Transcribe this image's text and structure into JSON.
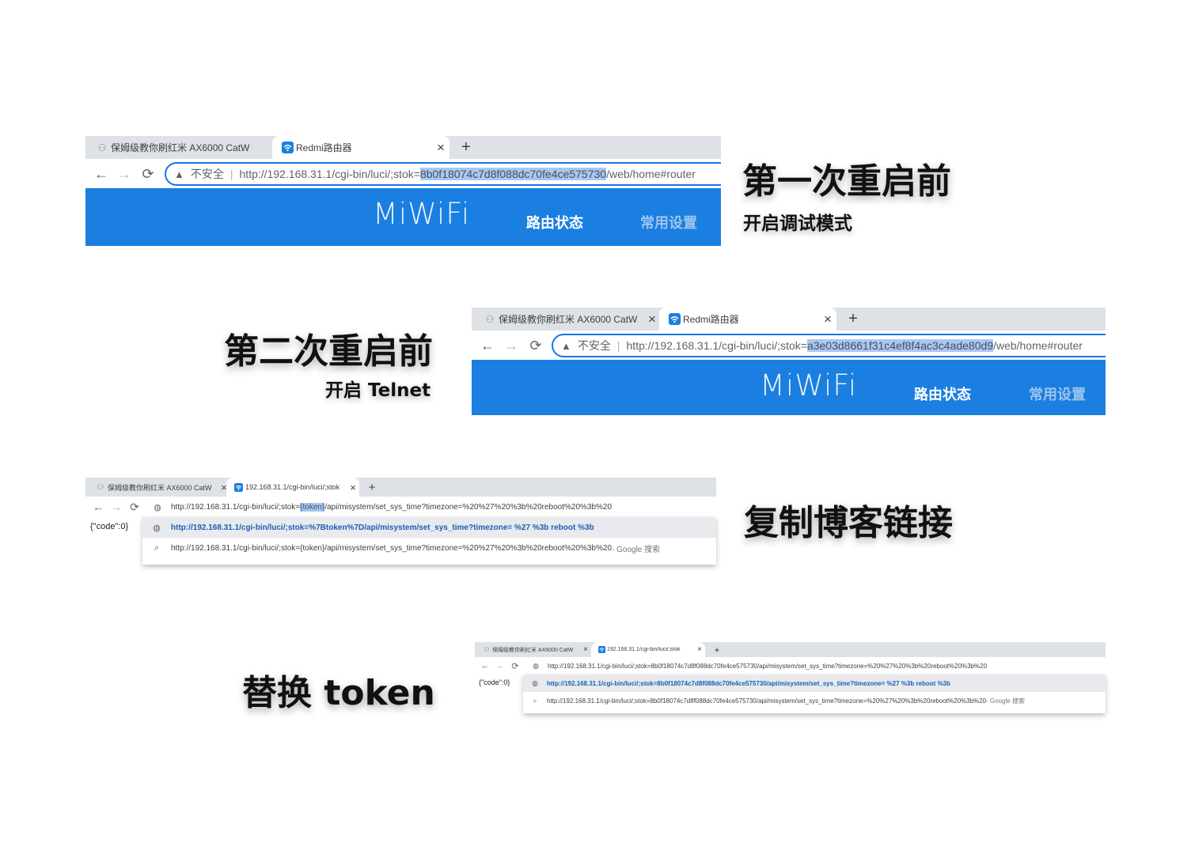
{
  "panel1": {
    "tab1_title": "保姆级教你刷红米 AX6000 CatW",
    "tab2_title": "Redmi路由器",
    "close": "×",
    "newtab": "+",
    "insecure_label": "不安全",
    "separator": "|",
    "url_prefix": "http://192.168.31.1/cgi-bin/luci/;stok=",
    "url_token": "8b0f18074c7d8f088dc70fe4ce575730",
    "url_suffix": "/web/home#router",
    "logo": "MiWiFi",
    "nav_status": "路由状态",
    "nav_settings": "常用设置",
    "caption": "第一次重启前",
    "subcaption": "开启调试模式"
  },
  "panel2": {
    "tab1_title": "保姆级教你刷红米 AX6000 CatW",
    "tab2_title": "Redmi路由器",
    "close": "×",
    "newtab": "+",
    "insecure_label": "不安全",
    "separator": "|",
    "url_prefix": "http://192.168.31.1/cgi-bin/luci/;stok=",
    "url_token": "a3e03d8661f31c4ef8f4ac3c4ade80d9",
    "url_suffix": "/web/home#router",
    "logo": "MiWiFi",
    "nav_status": "路由状态",
    "nav_settings": "常用设置",
    "caption": "第二次重启前",
    "subcaption": "开启 Telnet"
  },
  "panel3": {
    "tab1_title": "保姆级教你刷红米 AX6000 CatW",
    "tab2_title": "192.168.31.1/cgi-bin/luci/;stok",
    "close": "×",
    "newtab": "+",
    "url_prefix": "http://192.168.31.1/cgi-bin/luci/;stok=",
    "url_token": "{token}",
    "url_suffix": "/api/misystem/set_sys_time?timezone=%20%27%20%3b%20reboot%20%3b%20",
    "page_text": "{\"code\":0}",
    "suggestion1": "http://192.168.31.1/cgi-bin/luci/;stok=%7Btoken%7D/api/misystem/set_sys_time?timezone= %27 %3b reboot %3b",
    "suggestion2": "http://192.168.31.1/cgi-bin/luci/;stok={token}/api/misystem/set_sys_time?timezone=%20%27%20%3b%20reboot%20%3b%20",
    "suggestion2_tail": " - Google 搜索",
    "caption": "复制博客链接"
  },
  "panel4": {
    "tab1_title": "保姆级教你刷红米 AX6000 CatW",
    "tab2_title": "192.168.31.1/cgi-bin/luci/;stok",
    "close": "×",
    "newtab": "+",
    "url": "http://192.168.31.1/cgi-bin/luci/;stok=8b0f18074c7d8f088dc70fe4ce575730/api/misystem/set_sys_time?timezone=%20%27%20%3b%20reboot%20%3b%20",
    "page_text": "{\"code\":0}",
    "suggestion1": "http://192.168.31.1/cgi-bin/luci/;stok=8b0f18074c7d8f088dc70fe4ce575730/api/misystem/set_sys_time?timezone= %27 %3b reboot %3b",
    "suggestion2": "http://192.168.31.1/cgi-bin/luci/;stok=8b0f18074c7d8f088dc70fe4ce575730/api/misystem/set_sys_time?timezone=%20%27%20%3b%20reboot%20%3b%20",
    "suggestion2_tail": " - Google 搜索",
    "caption": "替换 token"
  }
}
